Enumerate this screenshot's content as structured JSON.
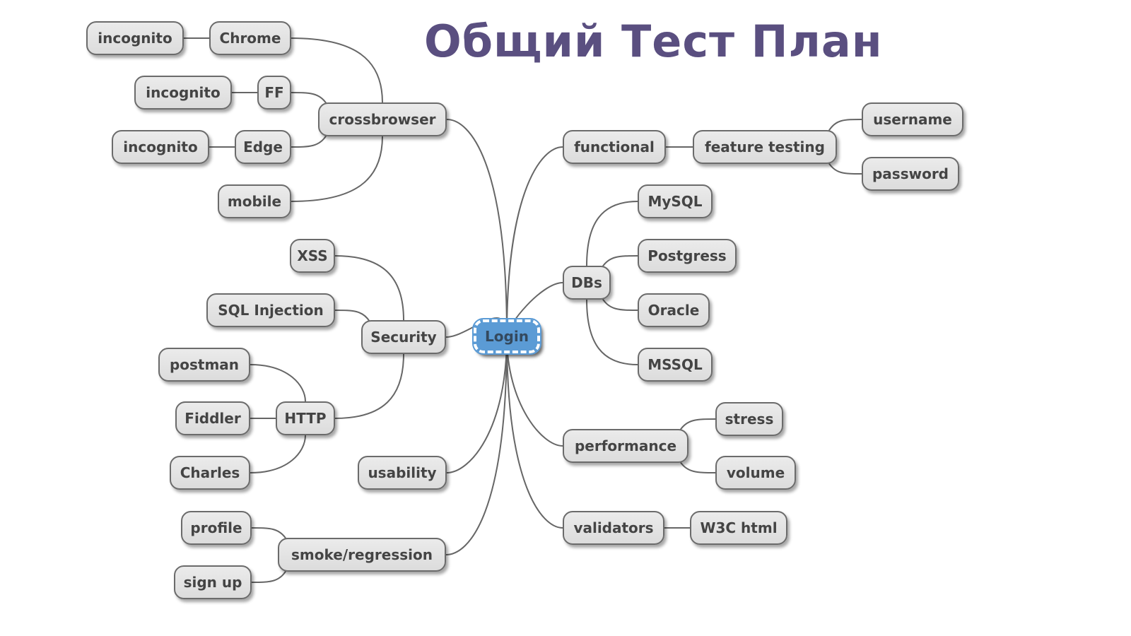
{
  "title": "Общий Тест План",
  "colors": {
    "title": "#5a4f80",
    "root_fill": "#5b9bd5",
    "node_fill": "#e2e2e2",
    "edge": "#666666"
  },
  "mindmap": {
    "root": {
      "id": "login",
      "label": "Login"
    },
    "nodes": [
      {
        "id": "crossbrowser",
        "label": "crossbrowser",
        "parent": "login"
      },
      {
        "id": "chrome",
        "label": "Chrome",
        "parent": "crossbrowser"
      },
      {
        "id": "chrome-incognito",
        "label": "incognito",
        "parent": "chrome"
      },
      {
        "id": "ff",
        "label": "FF",
        "parent": "crossbrowser"
      },
      {
        "id": "ff-incognito",
        "label": "incognito",
        "parent": "ff"
      },
      {
        "id": "edge",
        "label": "Edge",
        "parent": "crossbrowser"
      },
      {
        "id": "edge-incognito",
        "label": "incognito",
        "parent": "edge"
      },
      {
        "id": "mobile",
        "label": "mobile",
        "parent": "crossbrowser"
      },
      {
        "id": "security",
        "label": "Security",
        "parent": "login"
      },
      {
        "id": "xss",
        "label": "XSS",
        "parent": "security"
      },
      {
        "id": "sql-injection",
        "label": "SQL Injection",
        "parent": "security"
      },
      {
        "id": "http",
        "label": "HTTP",
        "parent": "security"
      },
      {
        "id": "postman",
        "label": "postman",
        "parent": "http"
      },
      {
        "id": "fiddler",
        "label": "Fiddler",
        "parent": "http"
      },
      {
        "id": "charles",
        "label": "Charles",
        "parent": "http"
      },
      {
        "id": "usability",
        "label": "usability",
        "parent": "login"
      },
      {
        "id": "smoke-regression",
        "label": "smoke/regression",
        "parent": "login"
      },
      {
        "id": "profile",
        "label": "profile",
        "parent": "smoke-regression"
      },
      {
        "id": "sign-up",
        "label": "sign up",
        "parent": "smoke-regression"
      },
      {
        "id": "functional",
        "label": "functional",
        "parent": "login"
      },
      {
        "id": "feature-testing",
        "label": "feature testing",
        "parent": "functional"
      },
      {
        "id": "username",
        "label": "username",
        "parent": "feature-testing"
      },
      {
        "id": "password",
        "label": "password",
        "parent": "feature-testing"
      },
      {
        "id": "dbs",
        "label": "DBs",
        "parent": "login"
      },
      {
        "id": "mysql",
        "label": "MySQL",
        "parent": "dbs"
      },
      {
        "id": "postgress",
        "label": "Postgress",
        "parent": "dbs"
      },
      {
        "id": "oracle",
        "label": "Oracle",
        "parent": "dbs"
      },
      {
        "id": "mssql",
        "label": "MSSQL",
        "parent": "dbs"
      },
      {
        "id": "performance",
        "label": "performance",
        "parent": "login"
      },
      {
        "id": "stress",
        "label": "stress",
        "parent": "performance"
      },
      {
        "id": "volume",
        "label": "volume",
        "parent": "performance"
      },
      {
        "id": "validators",
        "label": "validators",
        "parent": "login"
      },
      {
        "id": "w3c-html",
        "label": "W3C html",
        "parent": "validators"
      }
    ]
  }
}
